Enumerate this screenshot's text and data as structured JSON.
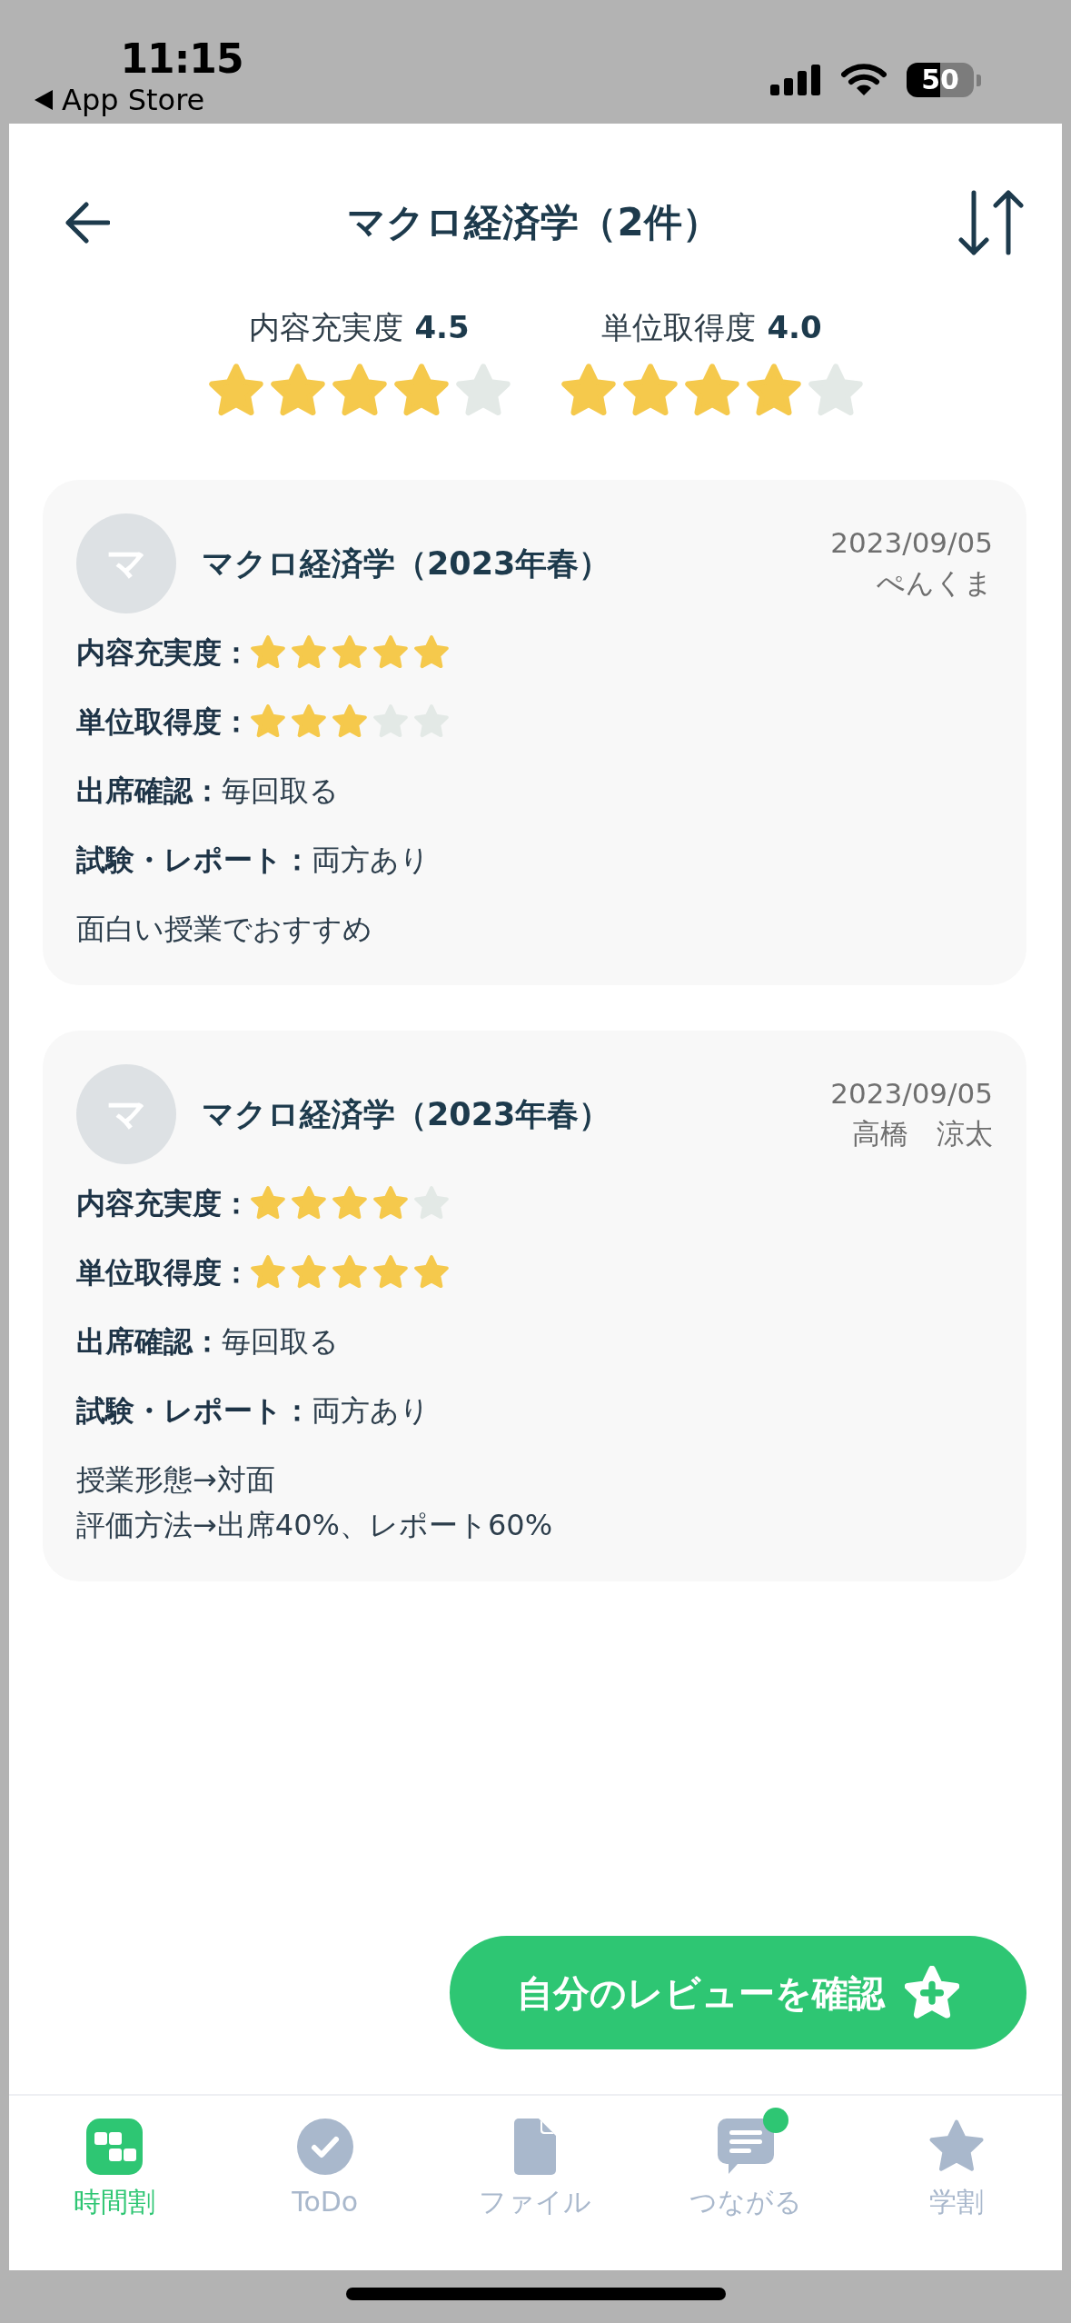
{
  "status_bar": {
    "time": "11:15",
    "back_label": "App Store",
    "battery": "50"
  },
  "header": {
    "title": "マクロ経済学（2件）"
  },
  "summary": [
    {
      "label": "内容充実度",
      "score": "4.5",
      "stars": 4
    },
    {
      "label": "単位取得度",
      "score": "4.0",
      "stars": 4
    }
  ],
  "reviews": [
    {
      "avatar": "マ",
      "course": "マクロ経済学（2023年春）",
      "date": "2023/09/05",
      "author": "ぺんくま",
      "ratings": [
        {
          "label": "内容充実度：",
          "stars": 5
        },
        {
          "label": "単位取得度：",
          "stars": 3
        }
      ],
      "fields": [
        {
          "label": "出席確認：",
          "value": "毎回取る"
        },
        {
          "label": "試験・レポート：",
          "value": "両方あり"
        }
      ],
      "comment": [
        "面白い授業でおすすめ"
      ]
    },
    {
      "avatar": "マ",
      "course": "マクロ経済学（2023年春）",
      "date": "2023/09/05",
      "author": "高橋　涼太",
      "ratings": [
        {
          "label": "内容充実度：",
          "stars": 4
        },
        {
          "label": "単位取得度：",
          "stars": 5
        }
      ],
      "fields": [
        {
          "label": "出席確認：",
          "value": "毎回取る"
        },
        {
          "label": "試験・レポート：",
          "value": "両方あり"
        }
      ],
      "comment": [
        "授業形態→対面",
        "評価方法→出席40%、レポート60%"
      ]
    }
  ],
  "fab": {
    "label": "自分のレビューを確認"
  },
  "tab_bar": [
    {
      "label": "時間割",
      "kind": "timetable",
      "selected": true,
      "unread": false
    },
    {
      "label": "ToDo",
      "kind": "todo",
      "selected": false,
      "unread": false
    },
    {
      "label": "ファイル",
      "kind": "file",
      "selected": false,
      "unread": false
    },
    {
      "label": "つながる",
      "kind": "chat",
      "selected": false,
      "unread": true
    },
    {
      "label": "学割",
      "kind": "star",
      "selected": false,
      "unread": false
    }
  ]
}
